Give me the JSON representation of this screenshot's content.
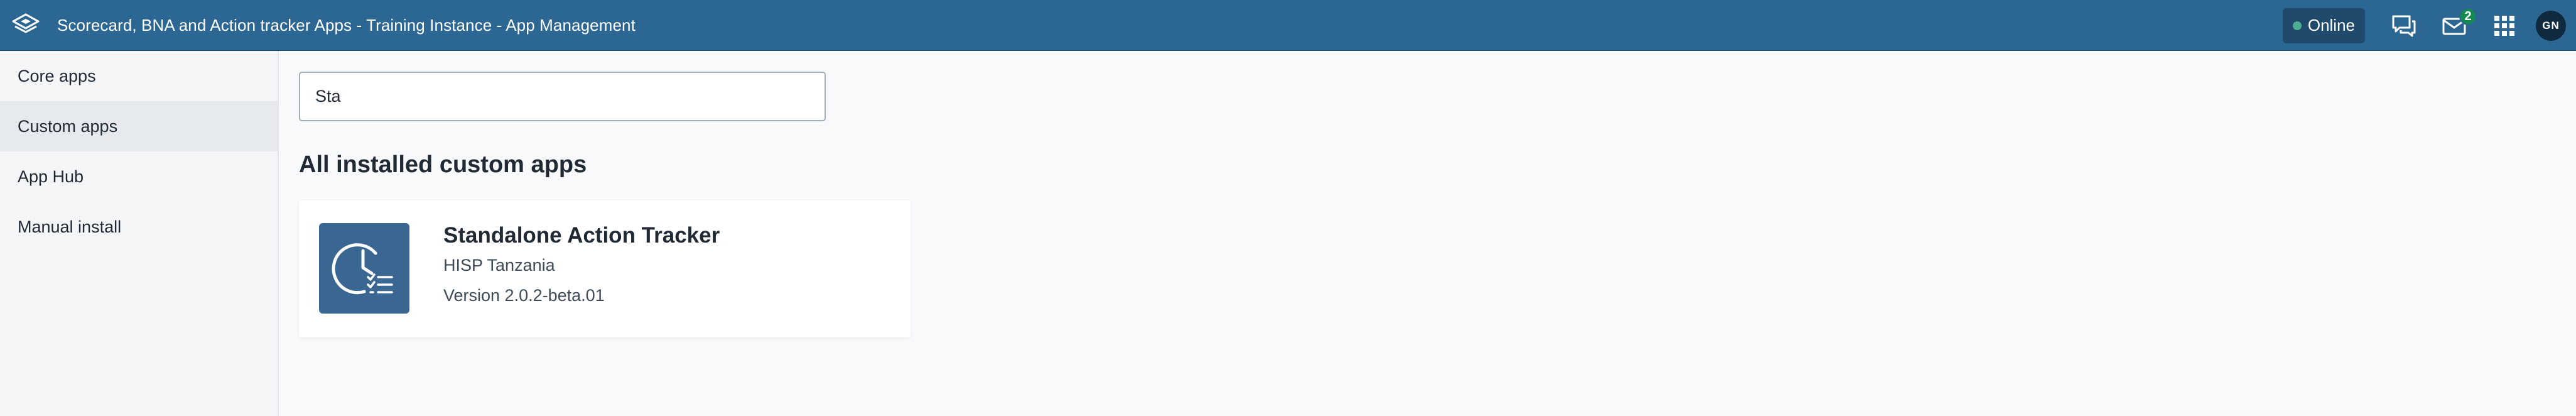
{
  "header": {
    "title": "Scorecard, BNA and Action tracker Apps - Training Instance - App Management",
    "logo_icon": "dhis2-logo-icon",
    "status": "Online",
    "status_color": "#4caf92",
    "icons": [
      "interpretations-icon",
      "messages-icon",
      "apps-grid-icon"
    ],
    "message_count": "2",
    "avatar_initials": "GN",
    "background": "#2c6693"
  },
  "sidebar": {
    "items": [
      {
        "label": "Core apps",
        "active": false
      },
      {
        "label": "Custom apps",
        "active": true
      },
      {
        "label": "App Hub",
        "active": false
      },
      {
        "label": "Manual install",
        "active": false
      }
    ]
  },
  "search": {
    "value": "Sta",
    "placeholder": ""
  },
  "main": {
    "section_title": "All installed custom apps",
    "apps": [
      {
        "name": "Standalone Action Tracker",
        "developer": "HISP Tanzania",
        "version": "Version 2.0.2-beta.01",
        "icon": "clock-checklist-icon",
        "icon_color": "#3a6692"
      }
    ]
  }
}
